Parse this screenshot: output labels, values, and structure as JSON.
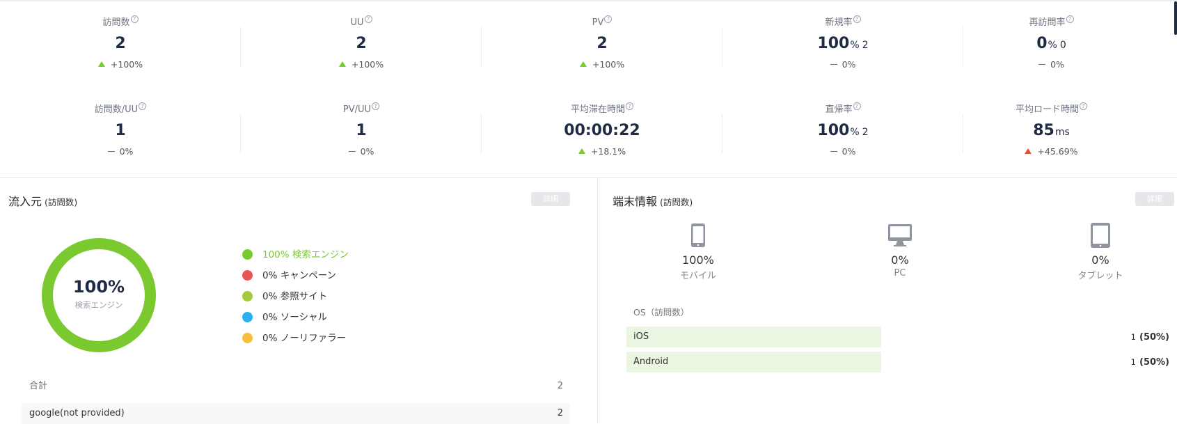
{
  "metrics_row1": [
    {
      "label": "訪問数",
      "value": "2",
      "unit": "",
      "sub": "",
      "change": "+100%",
      "trend": "up-green"
    },
    {
      "label": "UU",
      "value": "2",
      "unit": "",
      "sub": "",
      "change": "+100%",
      "trend": "up-green"
    },
    {
      "label": "PV",
      "value": "2",
      "unit": "",
      "sub": "",
      "change": "+100%",
      "trend": "up-green"
    },
    {
      "label": "新規率",
      "value": "100",
      "unit": "%",
      "sub": "2",
      "change": "0%",
      "trend": "flat"
    },
    {
      "label": "再訪問率",
      "value": "0",
      "unit": "%",
      "sub": "0",
      "change": "0%",
      "trend": "flat"
    }
  ],
  "metrics_row2": [
    {
      "label": "訪問数/UU",
      "value": "1",
      "unit": "",
      "sub": "",
      "change": "0%",
      "trend": "flat"
    },
    {
      "label": "PV/UU",
      "value": "1",
      "unit": "",
      "sub": "",
      "change": "0%",
      "trend": "flat"
    },
    {
      "label": "平均滞在時間",
      "value": "00:00:22",
      "unit": "",
      "sub": "",
      "change": "+18.1%",
      "trend": "up-green"
    },
    {
      "label": "直帰率",
      "value": "100",
      "unit": "%",
      "sub": "2",
      "change": "0%",
      "trend": "flat"
    },
    {
      "label": "平均ロード時間",
      "value": "85",
      "unit": "ms",
      "sub": "",
      "change": "+45.69%",
      "trend": "up-red"
    }
  ],
  "help_glyph": "?",
  "traffic": {
    "title": "流入元",
    "title_sub": "(訪問数)",
    "detail_label": "詳細",
    "donut_value": "100%",
    "donut_label": "検索エンジン",
    "donut_fraction": 1.0,
    "donut_color": "#7ac92f",
    "legend": [
      {
        "text": "100%  検索エンジン",
        "color": "#7ac92f",
        "active": true
      },
      {
        "text": "0%  キャンペーン",
        "color": "#e85555",
        "active": false
      },
      {
        "text": "0%  参照サイト",
        "color": "#a3c93f",
        "active": false
      },
      {
        "text": "0%  ソーシャル",
        "color": "#29b0ef",
        "active": false
      },
      {
        "text": "0%  ノーリファラー",
        "color": "#f7be3e",
        "active": false
      }
    ],
    "total_label": "合計",
    "total_value": "2",
    "rows": [
      {
        "label": "google(not provided)",
        "value": "2"
      }
    ]
  },
  "device": {
    "title": "端末情報",
    "title_sub": "(訪問数)",
    "detail_label": "詳細",
    "items": [
      {
        "icon": "mobile-icon",
        "pct": "100%",
        "name": "モバイル"
      },
      {
        "icon": "pc-icon",
        "pct": "0%",
        "name": "PC"
      },
      {
        "icon": "tablet-icon",
        "pct": "0%",
        "name": "タブレット"
      }
    ],
    "os_title": "OS（訪問数）",
    "os": [
      {
        "name": "iOS",
        "count": "1",
        "pct": "(50%)",
        "share": 0.5
      },
      {
        "name": "Android",
        "count": "1",
        "pct": "(50%)",
        "share": 0.5
      }
    ]
  }
}
